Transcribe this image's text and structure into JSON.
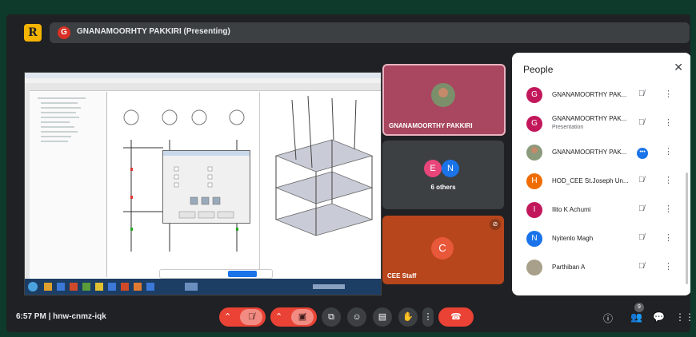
{
  "header": {
    "logo_letter": "R",
    "presenter_initial": "G",
    "presenter_label": "GNANAMOORHTY PAKKIRI (Presenting)"
  },
  "tiles": {
    "main": {
      "label": "GNANAMOORTHY PAKKIRI"
    },
    "others": {
      "initials": [
        "E",
        "N"
      ],
      "colors": [
        "#e8457a",
        "#1a73e8"
      ],
      "label": "6 others"
    },
    "cee": {
      "initial": "C",
      "label": "CEE Staff"
    }
  },
  "people": {
    "title": "People",
    "close": "✕",
    "rows": [
      {
        "initial": "G",
        "color": "#c2185b",
        "name": "GNANAMOORTHY PAK...",
        "mic": "muted"
      },
      {
        "initial": "G",
        "color": "#c2185b",
        "name": "GNANAMOORTHY PAK...",
        "subtitle": "Presentation",
        "mic": "muted"
      },
      {
        "initial": "",
        "color": "photo",
        "name": "GNANAMOORTHY PAK...",
        "mic": "talking"
      },
      {
        "initial": "H",
        "color": "#ef6c00",
        "name": "HOD_CEE St.Joseph Un...",
        "mic": "muted"
      },
      {
        "initial": "I",
        "color": "#c2185b",
        "name": "Ilito K Achumi",
        "mic": "muted"
      },
      {
        "initial": "N",
        "color": "#1a73e8",
        "name": "Nyitenlo Magh",
        "mic": "muted"
      },
      {
        "initial": "",
        "color": "photo2",
        "name": "Parthiban A",
        "mic": "muted"
      }
    ]
  },
  "bottom": {
    "time_code": "6:57 PM  |  hnw-cnmz-iqk",
    "people_count": "9"
  },
  "colors": {
    "end_call": "#ea4335",
    "accent": "#1a73e8"
  }
}
